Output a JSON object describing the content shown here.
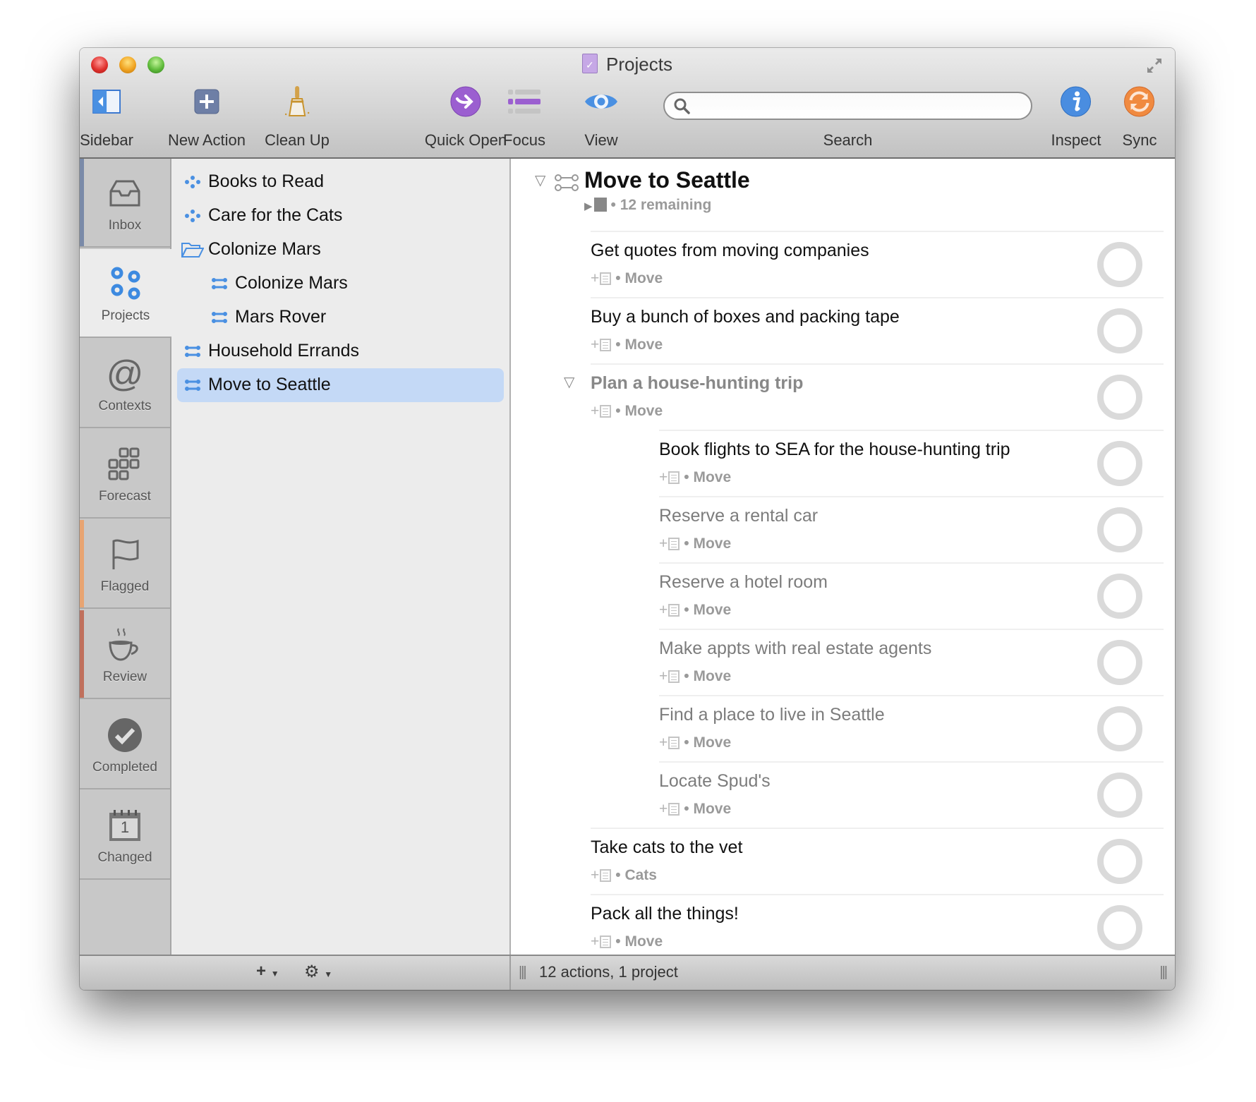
{
  "window": {
    "title": "Projects",
    "title_icon": "omnifocus-document-icon",
    "buttons": {
      "close": "close-button",
      "minimize": "minimize-button",
      "zoom": "zoom-button"
    }
  },
  "toolbar": {
    "sidebar_label": "Sidebar",
    "new_action_label": "New Action",
    "clean_up_label": "Clean Up",
    "quick_open_label": "Quick Open",
    "focus_label": "Focus",
    "view_label": "View",
    "search_label": "Search",
    "search_value": "",
    "search_placeholder": "",
    "inspect_label": "Inspect",
    "sync_label": "Sync"
  },
  "colors": {
    "accent_blue": "#4a90e2",
    "selection": "#c4d9f6",
    "quick_open_purple": "#9b59d0",
    "sync_orange": "#f08a40",
    "flagged_stripe": "#e8a472",
    "review_stripe": "#c0705c",
    "inbox_stripe": "#7a8aa8"
  },
  "perspectives": [
    {
      "label": "Inbox",
      "icon": "inbox-tray-icon"
    },
    {
      "label": "Projects",
      "icon": "projects-circles-icon",
      "selected": true
    },
    {
      "label": "Contexts",
      "icon": "at-sign-icon"
    },
    {
      "label": "Forecast",
      "icon": "forecast-grid-icon"
    },
    {
      "label": "Flagged",
      "icon": "flag-icon"
    },
    {
      "label": "Review",
      "icon": "coffee-cup-icon"
    },
    {
      "label": "Completed",
      "icon": "checkmark-circle-icon"
    },
    {
      "label": "Changed",
      "icon": "calendar-icon",
      "calendar_day": "1"
    }
  ],
  "project_list": [
    {
      "label": "Books to Read",
      "type": "single-action-list",
      "indent": 0
    },
    {
      "label": "Care for the Cats",
      "type": "single-action-list",
      "indent": 0
    },
    {
      "label": "Colonize Mars",
      "type": "folder",
      "indent": 0
    },
    {
      "label": "Colonize Mars",
      "type": "project",
      "indent": 1
    },
    {
      "label": "Mars Rover",
      "type": "project",
      "indent": 1
    },
    {
      "label": "Household Errands",
      "type": "project",
      "indent": 0
    },
    {
      "label": "Move to Seattle",
      "type": "project",
      "indent": 0,
      "selected": true
    }
  ],
  "content": {
    "project_title": "Move to Seattle",
    "project_remaining": "12 remaining",
    "tasks": [
      {
        "title": "Get quotes from moving companies",
        "context": "Move",
        "level": 0,
        "dim": false
      },
      {
        "title": "Buy a bunch of boxes and packing tape",
        "context": "Move",
        "level": 0,
        "dim": false
      },
      {
        "title": "Plan a house-hunting trip",
        "context": "Move",
        "level": 0,
        "group": true
      },
      {
        "title": "Book flights to SEA for the house-hunting trip",
        "context": "Move",
        "level": 1,
        "dim": false
      },
      {
        "title": "Reserve a rental car",
        "context": "Move",
        "level": 1,
        "dim": true
      },
      {
        "title": "Reserve a hotel room",
        "context": "Move",
        "level": 1,
        "dim": true
      },
      {
        "title": "Make appts with real estate agents",
        "context": "Move",
        "level": 1,
        "dim": true
      },
      {
        "title": "Find a place to live in Seattle",
        "context": "Move",
        "level": 1,
        "dim": true
      },
      {
        "title": "Locate Spud's",
        "context": "Move",
        "level": 1,
        "dim": true
      },
      {
        "title": "Take cats to the vet",
        "context": "Cats",
        "level": 0,
        "dim": false
      },
      {
        "title": "Pack all the things!",
        "context": "Move",
        "level": 0,
        "dim": false
      }
    ]
  },
  "bottom_bar": {
    "add_label": "+",
    "gear_label": "⚙",
    "status_text": "12 actions, 1 project"
  }
}
